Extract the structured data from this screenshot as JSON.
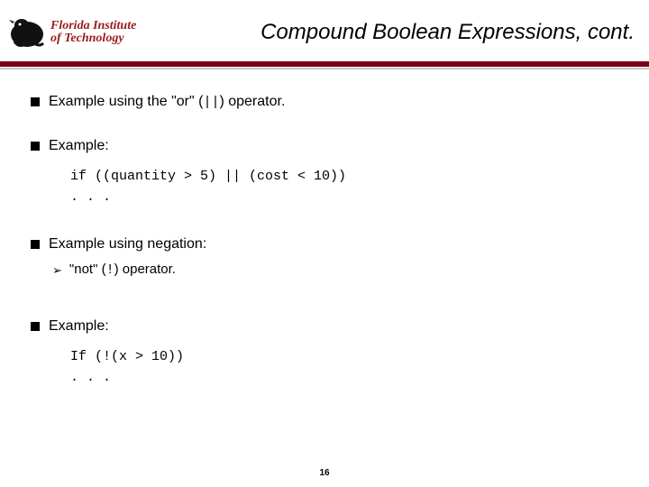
{
  "logo": {
    "line1": "Florida Institute",
    "line2": "of Technology"
  },
  "title": "Compound Boolean Expressions, cont.",
  "bullets": {
    "b1_pre": "Example using the \"or\" (",
    "b1_op": "||",
    "b1_post": ") operator.",
    "b2": "Example:",
    "code1": "if ((quantity > 5) || (cost < 10))",
    "dots1": ". . .",
    "b3": "Example using negation:",
    "sub3_pre": "\"not\" (",
    "sub3_op": "!",
    "sub3_post": ") operator.",
    "b4": "Example:",
    "code2": "If (!(x > 10))",
    "dots2": ". . ."
  },
  "page_number": "16"
}
